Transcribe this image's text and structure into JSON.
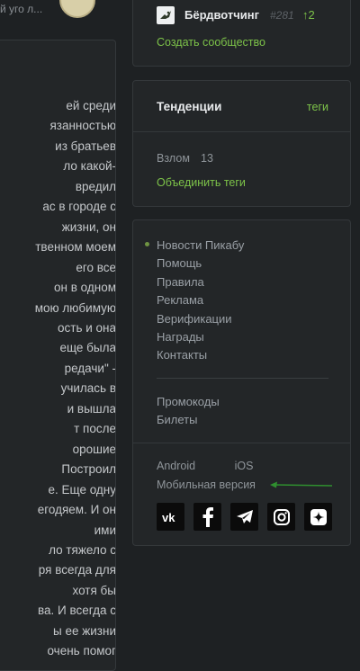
{
  "left_article": {
    "top_snippet": "й уго л...",
    "lines": [
      "ей среди",
      "язанностью",
      "из братьев",
      "ло какой-",
      "вредил",
      "ас в городе с",
      "жизни, он",
      "твенном моем",
      "его все",
      "он в одном",
      "мою любимую",
      "ость и она",
      "еще была",
      "редачи\" -",
      "училась в",
      "и вышла",
      "т после",
      "орошие",
      "Построил",
      "е. Еще одну",
      "егодяем. И он",
      "ими",
      "ло тяжело с",
      "ря всегда для",
      "хотя бы",
      "ва. И всегда с",
      "ы ее жизни",
      "очень помог"
    ]
  },
  "community": {
    "name": "Бёрдвотчинг",
    "rank": "#281",
    "up": "2",
    "create_link": "Создать сообщество"
  },
  "trends": {
    "title": "Тенденции",
    "tags_link": "теги",
    "item_name": "Взлом",
    "item_count": "13",
    "merge_link": "Объединить теги"
  },
  "footer": {
    "menu": [
      "Новости Пикабу",
      "Помощь",
      "Правила",
      "Реклама",
      "Верификации",
      "Награды",
      "Контакты"
    ],
    "menu2": [
      "Промокоды",
      "Билеты"
    ],
    "apps": {
      "android": "Android",
      "ios": "iOS"
    },
    "mobile": "Мобильная версия",
    "socials": [
      "vk-icon",
      "facebook-icon",
      "telegram-icon",
      "instagram-icon",
      "zen-icon"
    ],
    "accent_color": "#7dc349"
  }
}
